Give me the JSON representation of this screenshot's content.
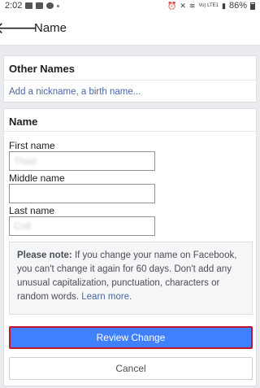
{
  "status_bar": {
    "time": "2:02",
    "battery": "86%",
    "network": "Vo) LTE1"
  },
  "header": {
    "back_icon": "arrow-left-icon",
    "title": "Name"
  },
  "other_names": {
    "title": "Other Names",
    "link": "Add a nickname, a birth name..."
  },
  "name_card": {
    "title": "Name",
    "first_name_label": "First name",
    "first_name_value": "Thad",
    "middle_name_label": "Middle name",
    "middle_name_value": "",
    "last_name_label": "Last name",
    "last_name_value": "Colt",
    "notice_bold": "Please note:",
    "notice_text": " If you change your name on Facebook, you can't change it again for 60 days. Don't add any unusual capitalization, punctuation, characters or random words. ",
    "notice_link": "Learn more",
    "notice_end": ".",
    "review_button": "Review Change",
    "cancel_button": "Cancel"
  },
  "colors": {
    "primary_button": "#4080ff",
    "highlight_border": "#c0152b",
    "link": "#4b67a1"
  }
}
